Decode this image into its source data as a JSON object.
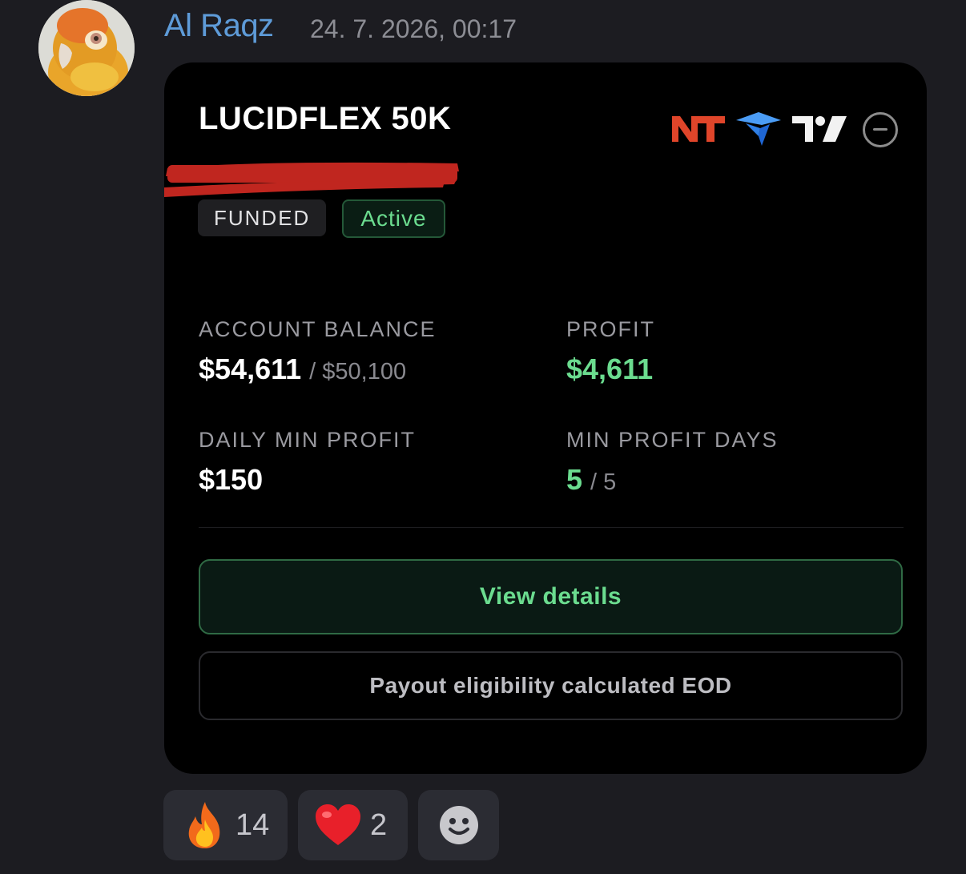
{
  "message": {
    "author": "Al Raqz",
    "timestamp": "24. 7. 2026, 00:17"
  },
  "card": {
    "title": "LUCIDFLEX 50K",
    "badges": {
      "funded": "FUNDED",
      "active": "Active"
    },
    "platform_icons": [
      "ninjatrader-logo-icon",
      "tradovate-logo-icon",
      "tradingview-logo-icon"
    ],
    "stats": {
      "account_balance": {
        "label": "ACCOUNT BALANCE",
        "value": "$54,611",
        "sub": "/ $50,100"
      },
      "profit": {
        "label": "PROFIT",
        "value": "$4,611"
      },
      "daily_min_profit": {
        "label": "DAILY MIN PROFIT",
        "value": "$150"
      },
      "min_profit_days": {
        "label": "MIN PROFIT DAYS",
        "value": "5",
        "sub": "/ 5"
      }
    },
    "buttons": {
      "view_details": "View details",
      "payout_note": "Payout eligibility calculated EOD"
    }
  },
  "reactions": [
    {
      "emoji": "fire-icon",
      "count": "14"
    },
    {
      "emoji": "heart-icon",
      "count": "2"
    },
    {
      "emoji": "add-reaction-icon"
    }
  ],
  "colors": {
    "background": "#1c1c21",
    "card": "#000000",
    "author": "#5e9bd8",
    "accent_green": "#6bdc8f",
    "redaction": "#c0261f"
  }
}
